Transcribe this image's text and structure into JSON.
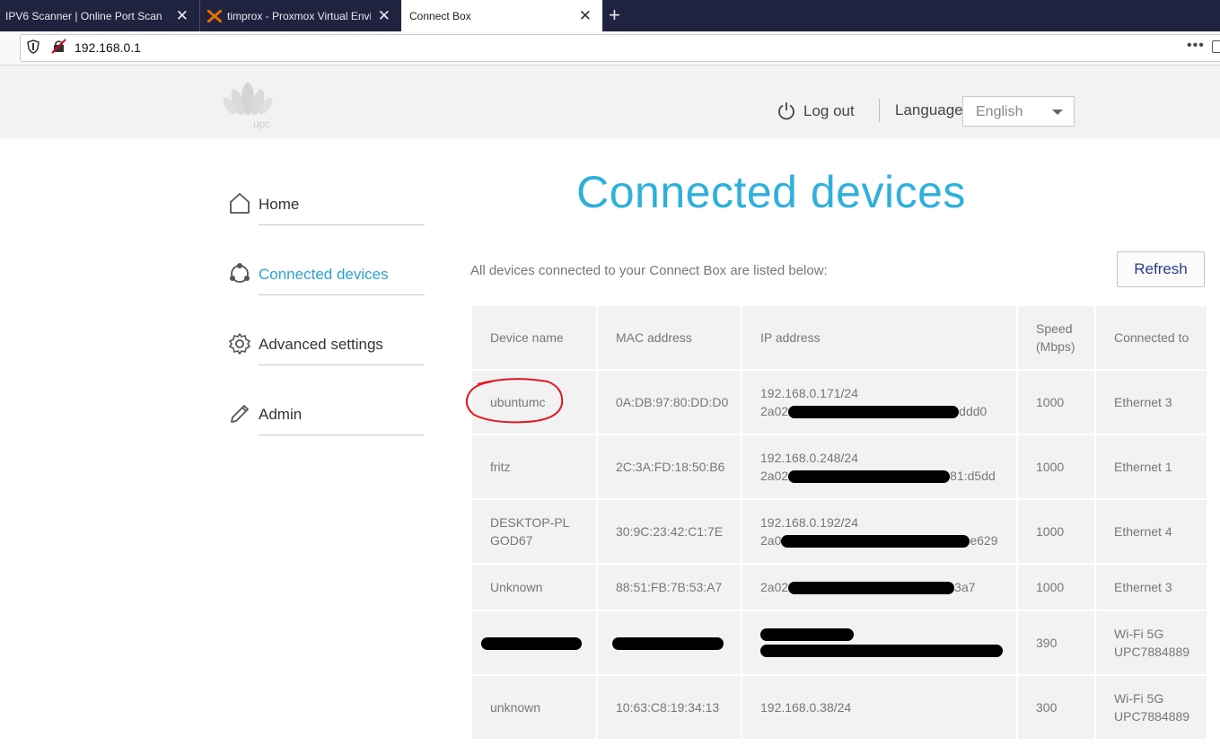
{
  "browser": {
    "tabs": [
      {
        "title": "IPV6 Scanner | Online Port Scan"
      },
      {
        "title": "timprox - Proxmox Virtual Environment"
      },
      {
        "title": "Connect Box"
      }
    ],
    "url": "192.168.0.1"
  },
  "header": {
    "logo_text": "upc",
    "logout_label": "Log out",
    "language_label": "Language",
    "language_value": "English"
  },
  "sidebar": {
    "items": [
      {
        "label": "Home",
        "icon": "home-icon"
      },
      {
        "label": "Connected devices",
        "icon": "devices-icon",
        "active": true
      },
      {
        "label": "Advanced settings",
        "icon": "gear-icon"
      },
      {
        "label": "Admin",
        "icon": "pencil-icon"
      }
    ]
  },
  "main": {
    "title": "Connected devices",
    "intro": "All devices connected to your Connect Box are listed below:",
    "refresh_label": "Refresh",
    "columns": [
      "Device name",
      "MAC address",
      "IP address",
      "Speed (Mbps)",
      "Connected to"
    ],
    "rows": [
      {
        "name": "ubuntumc",
        "mac": "0A:DB:97:80:DD:D0",
        "ip1": "192.168.0.171/24",
        "ip2_start": "2a02",
        "ip2_end": "ddd0",
        "speed": "1000",
        "connected": "Ethernet 3"
      },
      {
        "name": "fritz",
        "mac": "2C:3A:FD:18:50:B6",
        "ip1": "192.168.0.248/24",
        "ip2_start": "2a02",
        "ip2_end": "81:d5dd",
        "speed": "1000",
        "connected": "Ethernet 1"
      },
      {
        "name": "DESKTOP-PLGOD67",
        "mac": "30:9C:23:42:C1:7E",
        "ip1": "192.168.0.192/24",
        "ip2_start": "2a0",
        "ip2_end": "e629",
        "speed": "1000",
        "connected": "Ethernet 4"
      },
      {
        "name": "Unknown",
        "mac": "88:51:FB:7B:53:A7",
        "ip1": "",
        "ip2_start": "2a02",
        "ip2_end": "3a7",
        "speed": "1000",
        "connected": "Ethernet 3"
      },
      {
        "name": "",
        "mac": "",
        "ip1": "",
        "ip2_start": "",
        "ip2_end": "",
        "speed": "390",
        "connected": "Wi-Fi 5G UPC7884889"
      },
      {
        "name": "unknown",
        "mac": "10:63:C8:19:34:13",
        "ip1": "192.168.0.38/24",
        "ip2_start": "",
        "ip2_end": "",
        "speed": "300",
        "connected": "Wi-Fi 5G UPC7884889"
      }
    ]
  },
  "colors": {
    "accent": "#2fb0dc",
    "tabbar": "#202340",
    "annotation": "#e0191f"
  }
}
